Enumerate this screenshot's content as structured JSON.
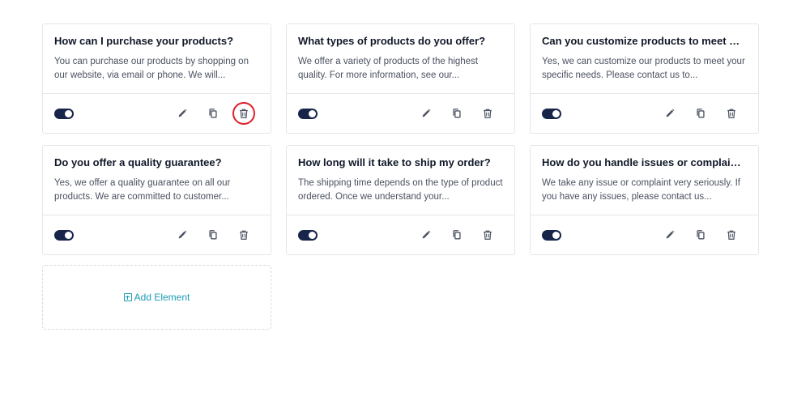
{
  "cards": [
    {
      "title": "How can I purchase your products?",
      "text": "You can purchase our products by shopping on our website, via email or phone. We will...",
      "enabled": true,
      "delete_highlighted": true
    },
    {
      "title": "What types of products do you offer?",
      "text": "We offer a variety of products of the highest quality. For more information, see our...",
      "enabled": true,
      "delete_highlighted": false
    },
    {
      "title": "Can you customize products to meet my ...",
      "text": "Yes, we can customize our products to meet your specific needs. Please contact us to...",
      "enabled": true,
      "delete_highlighted": false
    },
    {
      "title": "Do you offer a quality guarantee?",
      "text": "Yes, we offer a quality guarantee on all our products. We are committed to customer...",
      "enabled": true,
      "delete_highlighted": false
    },
    {
      "title": "How long will it take to ship my order?",
      "text": "The shipping time depends on the type of product ordered. Once we understand your...",
      "enabled": true,
      "delete_highlighted": false
    },
    {
      "title": "How do you handle issues or complaints?",
      "text": "We take any issue or complaint very seriously. If you have any issues, please contact us...",
      "enabled": true,
      "delete_highlighted": false
    }
  ],
  "add_element": {
    "label": "Add Element",
    "icon": "plus-square-icon"
  },
  "icons": {
    "edit": "pencil-icon",
    "duplicate": "copy-icon",
    "delete": "trash-icon"
  },
  "colors": {
    "toggle_on": "#17254a",
    "accent": "#1a9bb5",
    "highlight": "#e11d2a"
  }
}
